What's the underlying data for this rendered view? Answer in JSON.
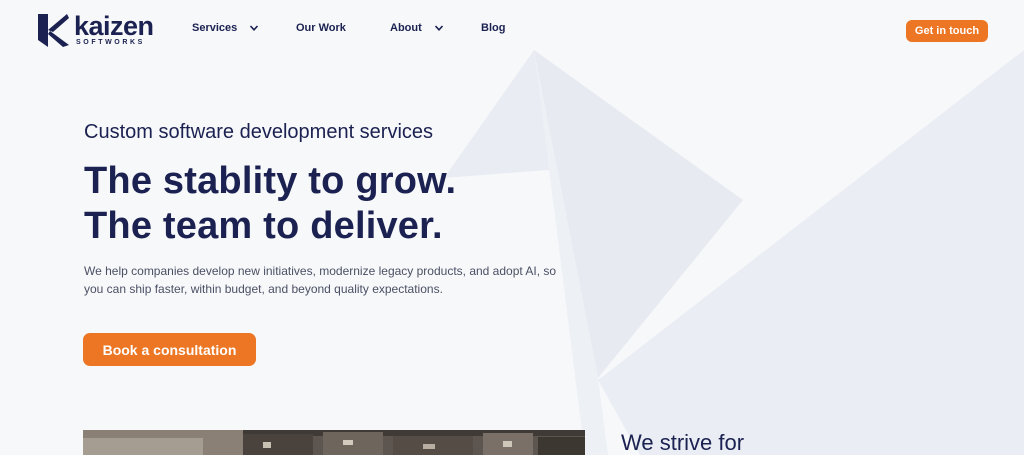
{
  "brand": {
    "name": "kaizen",
    "tagline": "SOFTWORKS",
    "logo_icon": "kaizen-k-icon"
  },
  "nav": {
    "items": [
      {
        "label": "Services",
        "has_dropdown": true
      },
      {
        "label": "Our Work",
        "has_dropdown": false
      },
      {
        "label": "About",
        "has_dropdown": true
      },
      {
        "label": "Blog",
        "has_dropdown": false
      }
    ],
    "dropdown_icon": "chevron-down-icon",
    "cta_label": "Get in touch"
  },
  "hero": {
    "eyebrow": "Custom software development services",
    "headline_line1": "The stablity to grow.",
    "headline_line2": "The team to deliver.",
    "lede": "We help companies develop new initiatives, modernize legacy products, and adopt AI, so you can ship faster, within budget, and beyond quality expectations.",
    "cta_label": "Book a consultation"
  },
  "section2": {
    "heading": "We strive for"
  },
  "colors": {
    "navy": "#1b2150",
    "orange": "#ec7623",
    "background": "#f7f8fa",
    "shape": "#e9edf3"
  }
}
